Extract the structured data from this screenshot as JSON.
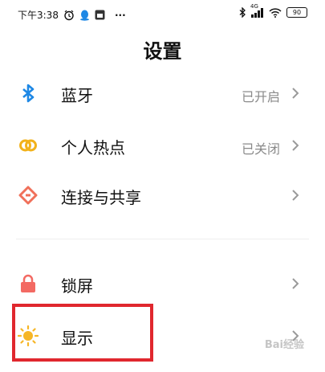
{
  "status_bar": {
    "time": "下午3:38",
    "more": "···",
    "network": "4G",
    "battery": "90",
    "icons": [
      "alarm-icon",
      "qq-icon",
      "app-icon",
      "bluetooth-icon",
      "signal-icon",
      "wifi-icon",
      "battery-icon"
    ]
  },
  "header": {
    "title": "设置"
  },
  "settings": [
    {
      "label": "蓝牙",
      "status": "已开启",
      "icon": "bluetooth-icon",
      "color": "#1e88e5"
    },
    {
      "label": "个人热点",
      "status": "已关闭",
      "icon": "hotspot-icon",
      "color": "#f2b21b"
    },
    {
      "label": "连接与共享",
      "status": "",
      "icon": "connection-icon",
      "color": "#f0705a"
    },
    {
      "label": "锁屏",
      "status": "",
      "icon": "lock-icon",
      "color": "#f36a63"
    },
    {
      "label": "显示",
      "status": "",
      "icon": "sun-icon",
      "color": "#f6b626"
    }
  ],
  "highlight_color": "#e0272e",
  "watermark": "Bai经验"
}
